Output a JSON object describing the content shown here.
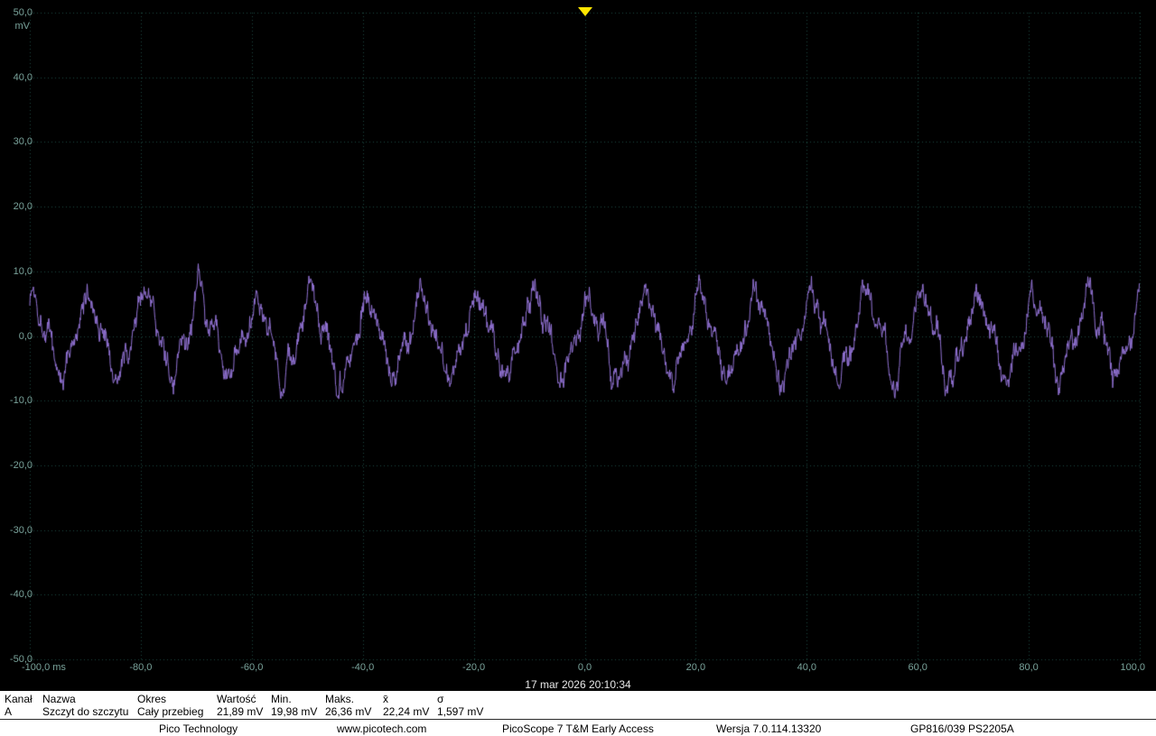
{
  "scope": {
    "timestamp": "17 mar 2026 20:10:34"
  },
  "chart_data": {
    "type": "line",
    "title": "",
    "x_unit": "ms",
    "y_unit": "mV",
    "x_range": [
      -100,
      100
    ],
    "y_range": [
      -50,
      50
    ],
    "x_ticks": [
      "-100,0 ms",
      "-80,0",
      "-60,0",
      "-40,0",
      "-20,0",
      "0,0",
      "20,0",
      "40,0",
      "60,0",
      "80,0",
      "100,0"
    ],
    "y_ticks": [
      "50,0",
      "40,0",
      "30,0",
      "20,0",
      "10,0",
      "0,0",
      "-10,0",
      "-20,0",
      "-30,0",
      "-40,0",
      "-50,0"
    ],
    "y_unit_label": "mV",
    "grid_on": true,
    "grid_color": "#1d4a40",
    "axis_label_color": "#79a29a",
    "trigger_color": "#ffe600",
    "series": [
      {
        "name": "Channel A",
        "color": "#9373d6",
        "period_ms": 10,
        "amplitude_mV": 6.0,
        "harmonic3_mV": 1.3,
        "noise_mV": 1.1,
        "phase": 1.0,
        "peak_to_peak_mV": 21.89
      }
    ]
  },
  "measurements": {
    "headers": [
      "Kanał",
      "Nazwa",
      "Okres",
      "Wartość",
      "Min.",
      "Maks.",
      "x̄",
      "σ"
    ],
    "rows": [
      [
        "A",
        "Szczyt do szczytu",
        "Cały przebieg",
        "21,89 mV",
        "19,98 mV",
        "26,36 mV",
        "22,24 mV",
        "1,597 mV"
      ]
    ]
  },
  "footer": {
    "company": "Pico Technology",
    "website": "www.picotech.com",
    "app": "PicoScope 7 T&M Early Access",
    "version": "Wersja 7.0.114.13320",
    "device": "GP816/039 PS2205A"
  }
}
